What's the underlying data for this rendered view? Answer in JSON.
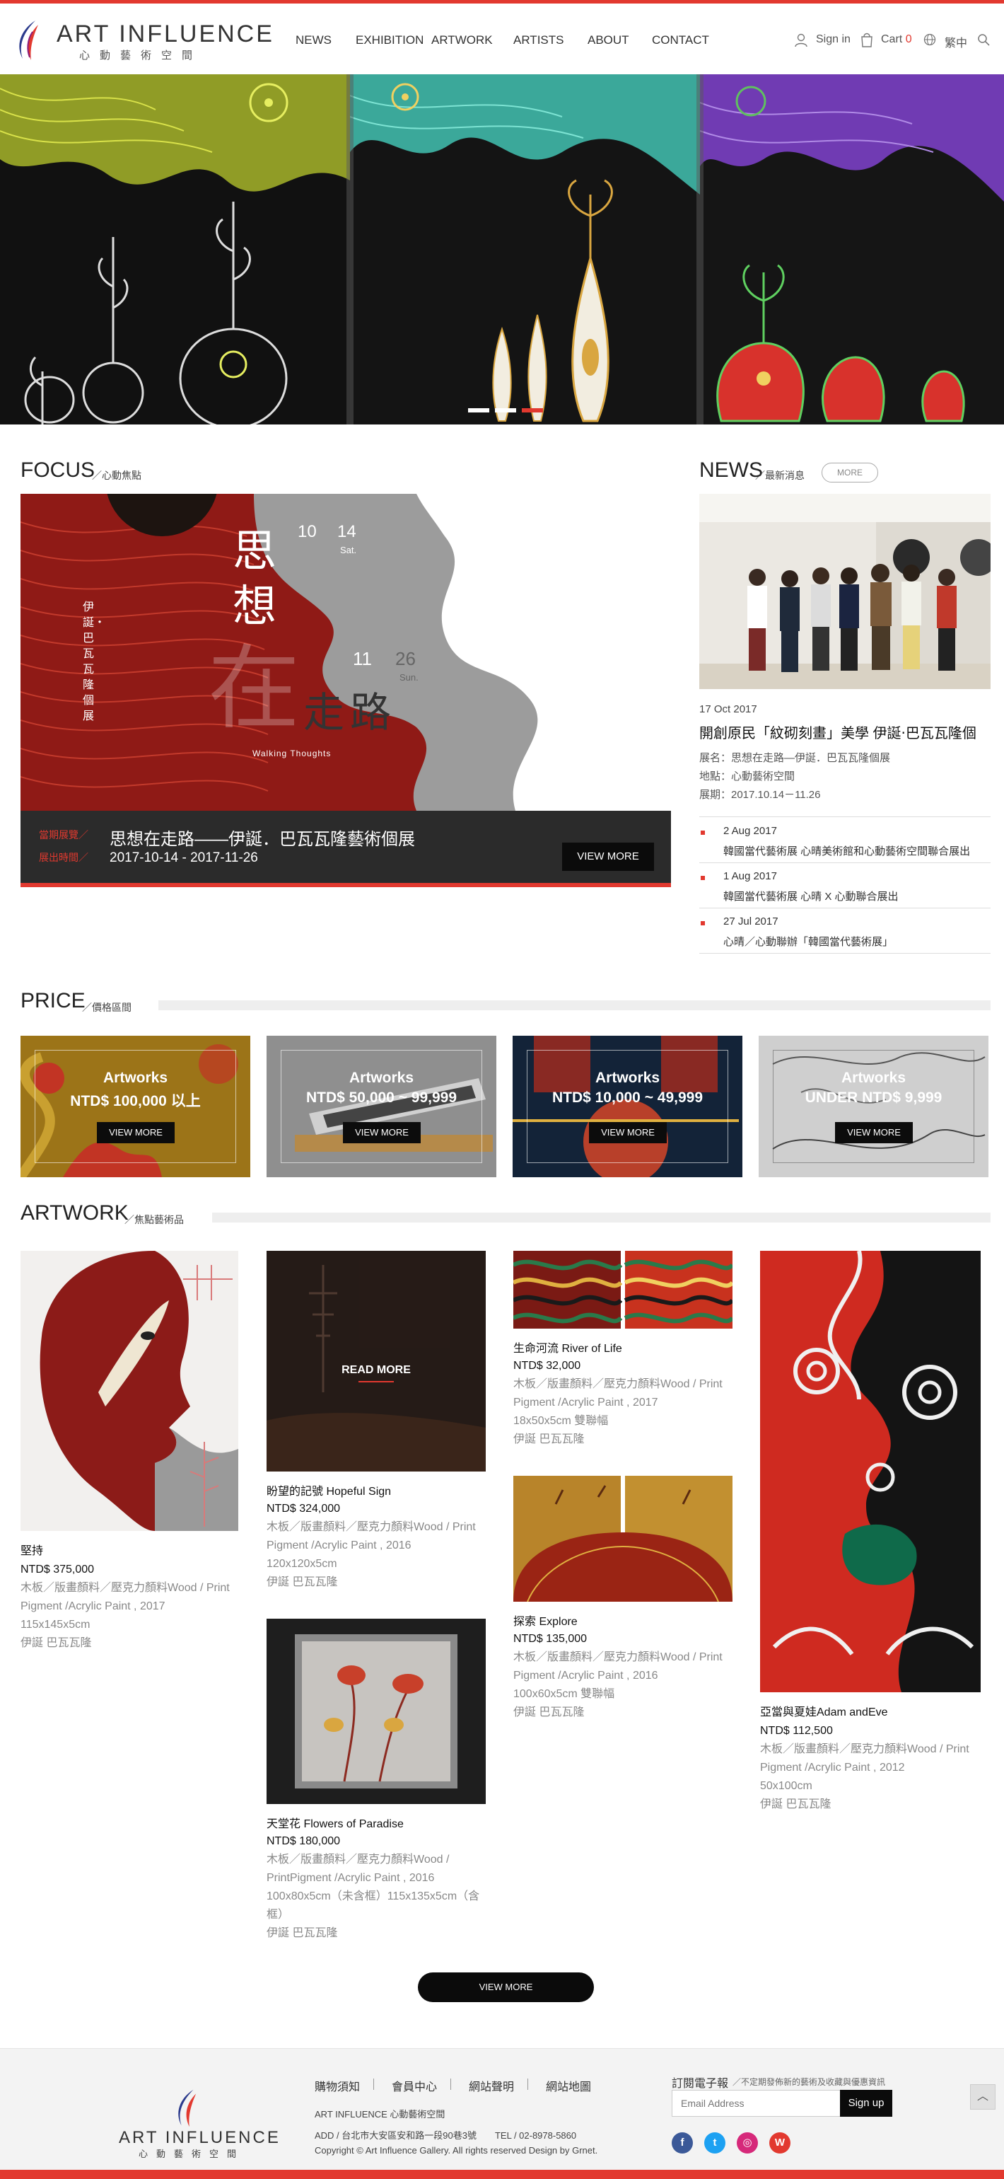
{
  "brand": {
    "name": "ART INFLUENCE",
    "sub": "心動藝術空間",
    "accent": "#e2392f"
  },
  "nav": {
    "items": [
      "NEWS",
      "EXHIBITION",
      "ARTWORK",
      "ARTISTS",
      "ABOUT",
      "CONTACT"
    ]
  },
  "header_tools": {
    "signin": "Sign in",
    "cart": "Cart",
    "cart_count": "0",
    "lang": "繁中"
  },
  "hero": {
    "slide_count": 3,
    "active_slide": 3
  },
  "focus": {
    "title": "FOCUS",
    "subtitle": "／心動焦點",
    "poster_title_chars": [
      "思",
      "想",
      "在",
      "走",
      "路"
    ],
    "poster_dates": {
      "start_month": "10",
      "start_day": "14",
      "start_wd": "Sat.",
      "end_month": "11",
      "end_day": "26",
      "end_wd": "Sun."
    },
    "poster_vertical": "伊誕・巴瓦瓦隆個展",
    "poster_english": "Walking Thoughts",
    "label_current": "當期展覽／",
    "label_period": "展出時間／",
    "exhibit_title": "思想在走路——伊誕．巴瓦瓦隆藝術個展",
    "exhibit_dates": "2017-10-14 - 2017-11-26",
    "button": "VIEW MORE"
  },
  "news": {
    "title": "NEWS",
    "subtitle": "／最新消息",
    "more": "MORE",
    "featured": {
      "date": "17 Oct 2017",
      "title": "開創原民「紋砌刻畫」美學 伊誕‧巴瓦瓦隆個",
      "lines": [
        "展名：思想在走路—伊誕．巴瓦瓦隆個展",
        "地點：心動藝術空間",
        "展期：2017.10.14－11.26"
      ]
    },
    "items": [
      {
        "date": "2 Aug 2017",
        "text": "韓國當代藝術展 心晴美術館和心動藝術空間聯合展出"
      },
      {
        "date": "1 Aug 2017",
        "text": "韓國當代藝術展 心晴 X 心動聯合展出"
      },
      {
        "date": "27 Jul 2017",
        "text": "心晴／心動聯辦「韓國當代藝術展」"
      }
    ]
  },
  "price": {
    "title": "PRICE",
    "subtitle": "／價格區間",
    "cards": [
      {
        "name": "Artworks",
        "range": "NTD$ 100,000 以上",
        "button": "VIEW MORE"
      },
      {
        "name": "Artworks",
        "range": "NTD$ 50,000 ~ 99,999",
        "button": "VIEW MORE"
      },
      {
        "name": "Artworks",
        "range": "NTD$ 10,000 ~ 49,999",
        "button": "VIEW MORE"
      },
      {
        "name": "Artworks",
        "range": "UNDER NTD$ 9,999",
        "button": "VIEW MORE"
      }
    ]
  },
  "artwork": {
    "title": "ARTWORK",
    "subtitle": "／焦點藝術品",
    "read_more": "READ MORE",
    "items": [
      {
        "title": "堅持",
        "price": "NTD$ 375,000",
        "desc": [
          "木板／版畫顏料／壓克力顏料Wood / Print",
          "Pigment /Acrylic Paint , 2017",
          "115x145x5cm",
          "伊誕 巴瓦瓦隆"
        ]
      },
      {
        "title": "盼望的記號 Hopeful Sign",
        "price": "NTD$ 324,000",
        "desc": [
          "木板／版畫顏料／壓克力顏料Wood / Print",
          "Pigment /Acrylic Paint , 2016",
          "120x120x5cm",
          "伊誕 巴瓦瓦隆"
        ]
      },
      {
        "title": "天堂花 Flowers of Paradise",
        "price": "NTD$ 180,000",
        "desc": [
          "木板／版畫顏料／壓克力顏料Wood /",
          "PrintPigment /Acrylic Paint , 2016",
          "100x80x5cm（未含框）115x135x5cm（含",
          "框）",
          "伊誕 巴瓦瓦隆"
        ]
      },
      {
        "title": "生命河流 River of Life",
        "price": "NTD$ 32,000",
        "desc": [
          "木板／版畫顏料／壓克力顏料Wood / Print",
          "Pigment /Acrylic Paint , 2017",
          "18x50x5cm 雙聯幅",
          "伊誕 巴瓦瓦隆"
        ]
      },
      {
        "title": "探索 Explore",
        "price": "NTD$ 135,000",
        "desc": [
          "木板／版畫顏料／壓克力顏料Wood / Print",
          "Pigment /Acrylic Paint , 2016",
          "100x60x5cm 雙聯幅",
          "伊誕 巴瓦瓦隆"
        ]
      },
      {
        "title": "亞當與夏娃Adam andEve",
        "price": "NTD$ 112,500",
        "desc": [
          "木板／版畫顏料／壓克力顏料Wood / Print",
          "Pigment /Acrylic Paint , 2012",
          "50x100cm",
          "伊誕 巴瓦瓦隆"
        ]
      }
    ],
    "view_more": "VIEW MORE"
  },
  "footer": {
    "links": [
      "購物須知",
      "會員中心",
      "網站聲明",
      "網站地圖"
    ],
    "company": "ART INFLUENCE 心動藝術空間",
    "address": "ADD / 台北市大安區安和路一段90巷3號　　TEL / 02-8978-5860",
    "copyright": "Copyright © Art Influence Gallery. All rights reserved Design by Grnet.",
    "newsletter_title": "訂閱電子報",
    "newsletter_sub": "／不定期發佈新的藝術及收藏與優惠資訊",
    "email_placeholder": "Email Address",
    "signup": "Sign up",
    "social": [
      {
        "icon": "facebook-icon",
        "glyph": "f",
        "color": "#3b5998"
      },
      {
        "icon": "twitter-icon",
        "glyph": "t",
        "color": "#1da1f2"
      },
      {
        "icon": "instagram-icon",
        "glyph": "◎",
        "color": "#d6297a"
      },
      {
        "icon": "weibo-icon",
        "glyph": "W",
        "color": "#e2392f"
      }
    ]
  }
}
